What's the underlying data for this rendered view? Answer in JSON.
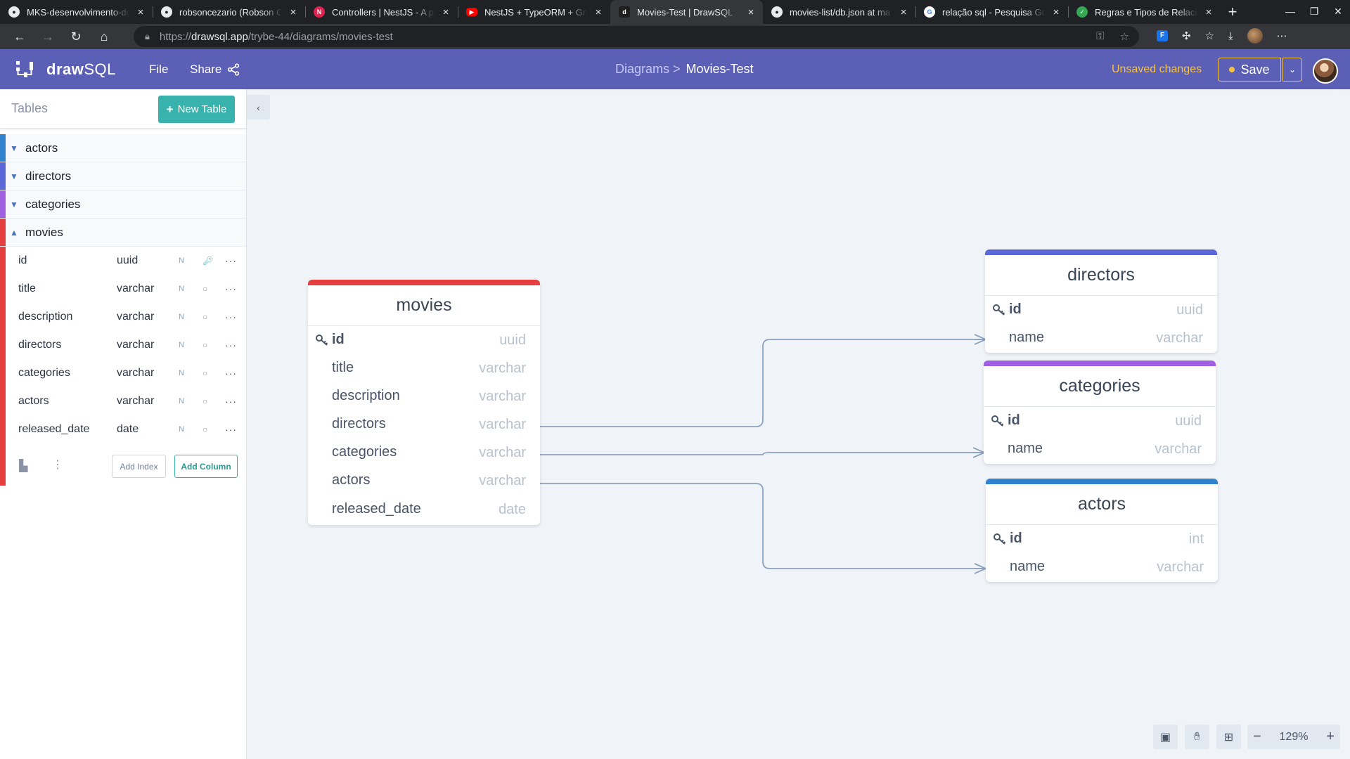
{
  "browser": {
    "tabs": [
      {
        "title": "MKS-desenvolvimento-de",
        "favicon": "github-icon",
        "color": "#e8eaed"
      },
      {
        "title": "robsoncezario (Robson Ce",
        "favicon": "github-icon",
        "color": "#e8eaed"
      },
      {
        "title": "Controllers | NestJS - A pr",
        "favicon": "nestjs-icon",
        "color": "#e0234e"
      },
      {
        "title": "NestJS + TypeORM + Grap",
        "favicon": "youtube-icon",
        "color": "#ff0000"
      },
      {
        "title": "Movies-Test | DrawSQL",
        "favicon": "drawsql-icon",
        "color": "#5b5fb6"
      },
      {
        "title": "movies-list/db.json at ma",
        "favicon": "github-icon",
        "color": "#e8eaed"
      },
      {
        "title": "relação sql - Pesquisa Go",
        "favicon": "google-icon",
        "color": "#4285f4"
      },
      {
        "title": "Regras e Tipos de Relacior",
        "favicon": "globe-icon",
        "color": "#34a853"
      }
    ],
    "active_tab": 4,
    "url_prefix": "https://",
    "url_domain": "drawsql.app",
    "url_path": "/trybe-44/diagrams/movies-test"
  },
  "header": {
    "logo_bold": "draw",
    "logo_rest": "SQL",
    "menu_file": "File",
    "menu_share": "Share",
    "crumb_parent": "Diagrams >",
    "crumb_current": "Movies-Test",
    "status": "Unsaved changes",
    "save_label": "Save",
    "brand_color": "#5b5fb6",
    "warn_color": "#f6c244"
  },
  "sidebar": {
    "title": "Tables",
    "new_table_label": "New Table",
    "tables": [
      {
        "name": "actors",
        "color": "#3182ce",
        "expanded": false
      },
      {
        "name": "directors",
        "color": "#5a67d8",
        "expanded": false
      },
      {
        "name": "categories",
        "color": "#9f5fe0",
        "expanded": false
      },
      {
        "name": "movies",
        "color": "#e53e3e",
        "expanded": true
      }
    ],
    "columns": [
      {
        "name": "id",
        "type": "uuid",
        "nullable": "N",
        "key": true
      },
      {
        "name": "title",
        "type": "varchar",
        "nullable": "N",
        "key": false
      },
      {
        "name": "description",
        "type": "varchar",
        "nullable": "N",
        "key": false
      },
      {
        "name": "directors",
        "type": "varchar",
        "nullable": "N",
        "key": false
      },
      {
        "name": "categories",
        "type": "varchar",
        "nullable": "N",
        "key": false
      },
      {
        "name": "actors",
        "type": "varchar",
        "nullable": "N",
        "key": false
      },
      {
        "name": "released_date",
        "type": "date",
        "nullable": "N",
        "key": false
      }
    ],
    "add_index_label": "Add Index",
    "add_column_label": "Add Column"
  },
  "diagram": {
    "movies": {
      "title": "movies",
      "color": "#e53e3e",
      "rows": [
        {
          "name": "id",
          "type": "uuid",
          "pk": true
        },
        {
          "name": "title",
          "type": "varchar",
          "pk": false
        },
        {
          "name": "description",
          "type": "varchar",
          "pk": false
        },
        {
          "name": "directors",
          "type": "varchar",
          "pk": false
        },
        {
          "name": "categories",
          "type": "varchar",
          "pk": false
        },
        {
          "name": "actors",
          "type": "varchar",
          "pk": false
        },
        {
          "name": "released_date",
          "type": "date",
          "pk": false
        }
      ]
    },
    "directors": {
      "title": "directors",
      "color": "#5a67d8",
      "rows": [
        {
          "name": "id",
          "type": "uuid",
          "pk": true
        },
        {
          "name": "name",
          "type": "varchar",
          "pk": false
        }
      ]
    },
    "categories": {
      "title": "categories",
      "color": "#9f5fe0",
      "rows": [
        {
          "name": "id",
          "type": "uuid",
          "pk": true
        },
        {
          "name": "name",
          "type": "varchar",
          "pk": false
        }
      ]
    },
    "actors": {
      "title": "actors",
      "color": "#3182ce",
      "rows": [
        {
          "name": "id",
          "type": "int",
          "pk": true
        },
        {
          "name": "name",
          "type": "varchar",
          "pk": false
        }
      ]
    }
  },
  "zoom": {
    "level": "129%"
  }
}
